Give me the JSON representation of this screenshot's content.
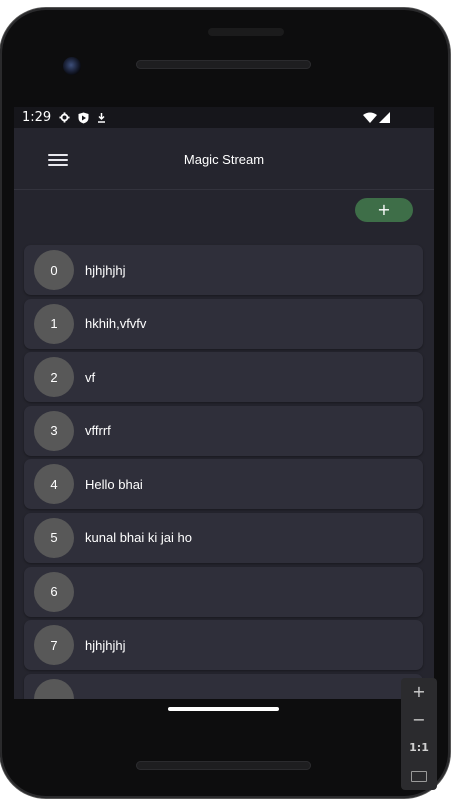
{
  "status_bar": {
    "time": "1:29",
    "left_icons": [
      "gear-icon",
      "shield-play-icon",
      "download-icon"
    ],
    "right_icons": [
      "wifi-icon",
      "cell-signal-icon"
    ]
  },
  "app_bar": {
    "title": "Magic Stream",
    "menu_icon": "hamburger-menu-icon"
  },
  "add_button": {
    "label": "+"
  },
  "items": [
    {
      "index": "0",
      "text": "hjhjhjhj"
    },
    {
      "index": "1",
      "text": "hkhih,vfvfv"
    },
    {
      "index": "2",
      "text": "vf"
    },
    {
      "index": "3",
      "text": "vffrrf"
    },
    {
      "index": "4",
      "text": "Hello bhai"
    },
    {
      "index": "5",
      "text": "kunal bhai ki jai ho"
    },
    {
      "index": "6",
      "text": ""
    },
    {
      "index": "7",
      "text": "hjhjhjhj"
    },
    {
      "index": "",
      "text": ""
    }
  ],
  "emulator_controls": {
    "zoom_in": "+",
    "zoom_out": "−",
    "one_to_one": "1:1"
  },
  "colors": {
    "screen_bg": "#25252e",
    "card_bg": "#2f2f3a",
    "avatar_bg": "#585858",
    "accent_green": "#3e6e48"
  }
}
